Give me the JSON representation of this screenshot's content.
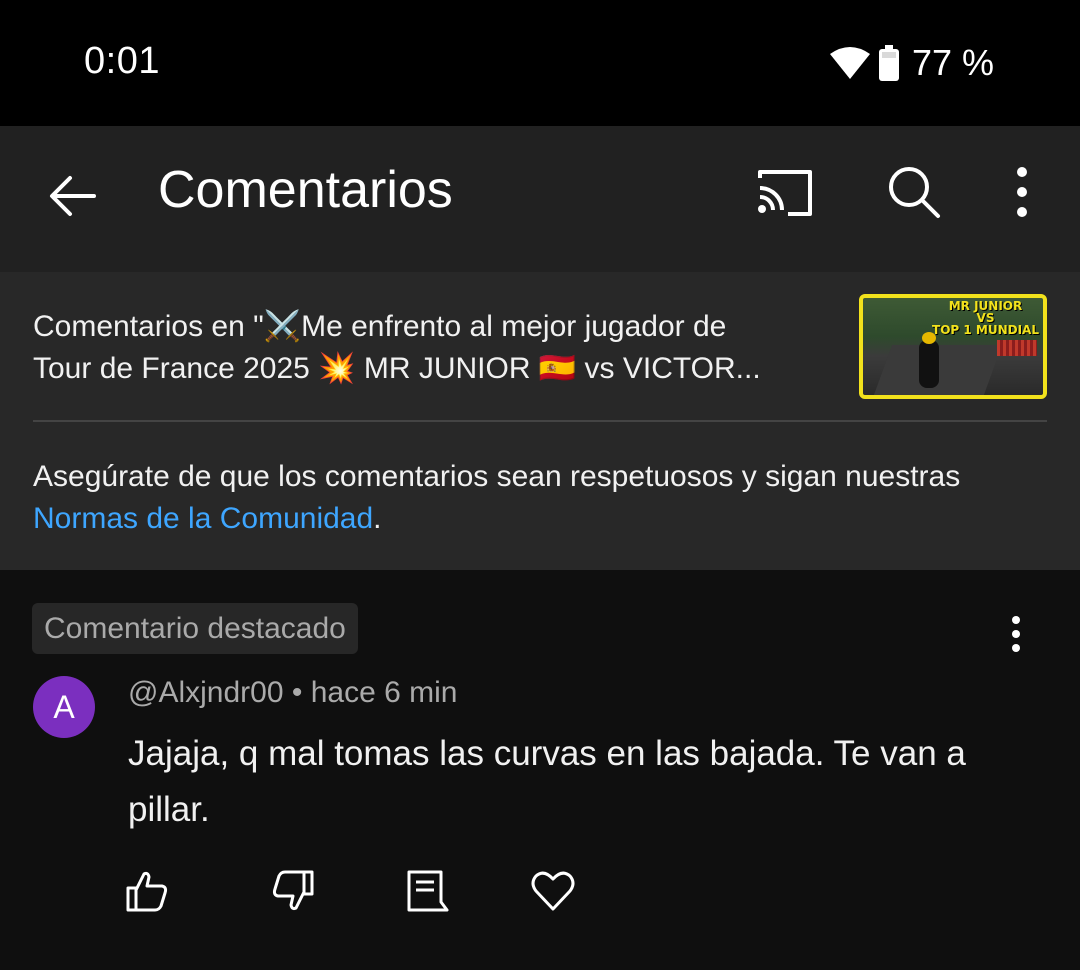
{
  "status_bar": {
    "time": "0:01",
    "battery": "77 %",
    "icons": [
      "wifi-icon",
      "battery-icon"
    ]
  },
  "app_bar": {
    "title": "Comentarios",
    "icons": [
      "back-arrow-icon",
      "cast-icon",
      "search-icon",
      "more-vert-icon"
    ]
  },
  "video": {
    "title_line1": "Comentarios en \"⚔️Me enfrento al mejor jugador de",
    "title_line2": "Tour de France 2025 💥 MR JUNIOR 🇪🇸 vs VICTOR...",
    "thumbnail": {
      "overlay_line1": "MR JUNIOR",
      "overlay_line2": "VS",
      "overlay_line3": "TOP 1 MUNDIAL"
    }
  },
  "guidelines": {
    "text_before": "Asegúrate de que los comentarios sean respetuosos y sigan nuestras ",
    "link": "Normas de la Comunidad",
    "text_after": "."
  },
  "comment": {
    "pinned_label": "Comentario destacado",
    "avatar_letter": "A",
    "author": "@Alxjndr00",
    "separator": "•",
    "time": "hace 6 min",
    "body": "Jajaja, q mal tomas las curvas en las bajada. Te van a pillar.",
    "actions": [
      "like-icon",
      "dislike-icon",
      "reply-icon",
      "heart-icon"
    ]
  },
  "colors": {
    "background": "#0f0f0f",
    "app_bar": "#212121",
    "header_panel": "#282828",
    "link": "#3ea6ff",
    "avatar": "#7b2fbf",
    "thumbnail_border": "#f2e21c"
  }
}
